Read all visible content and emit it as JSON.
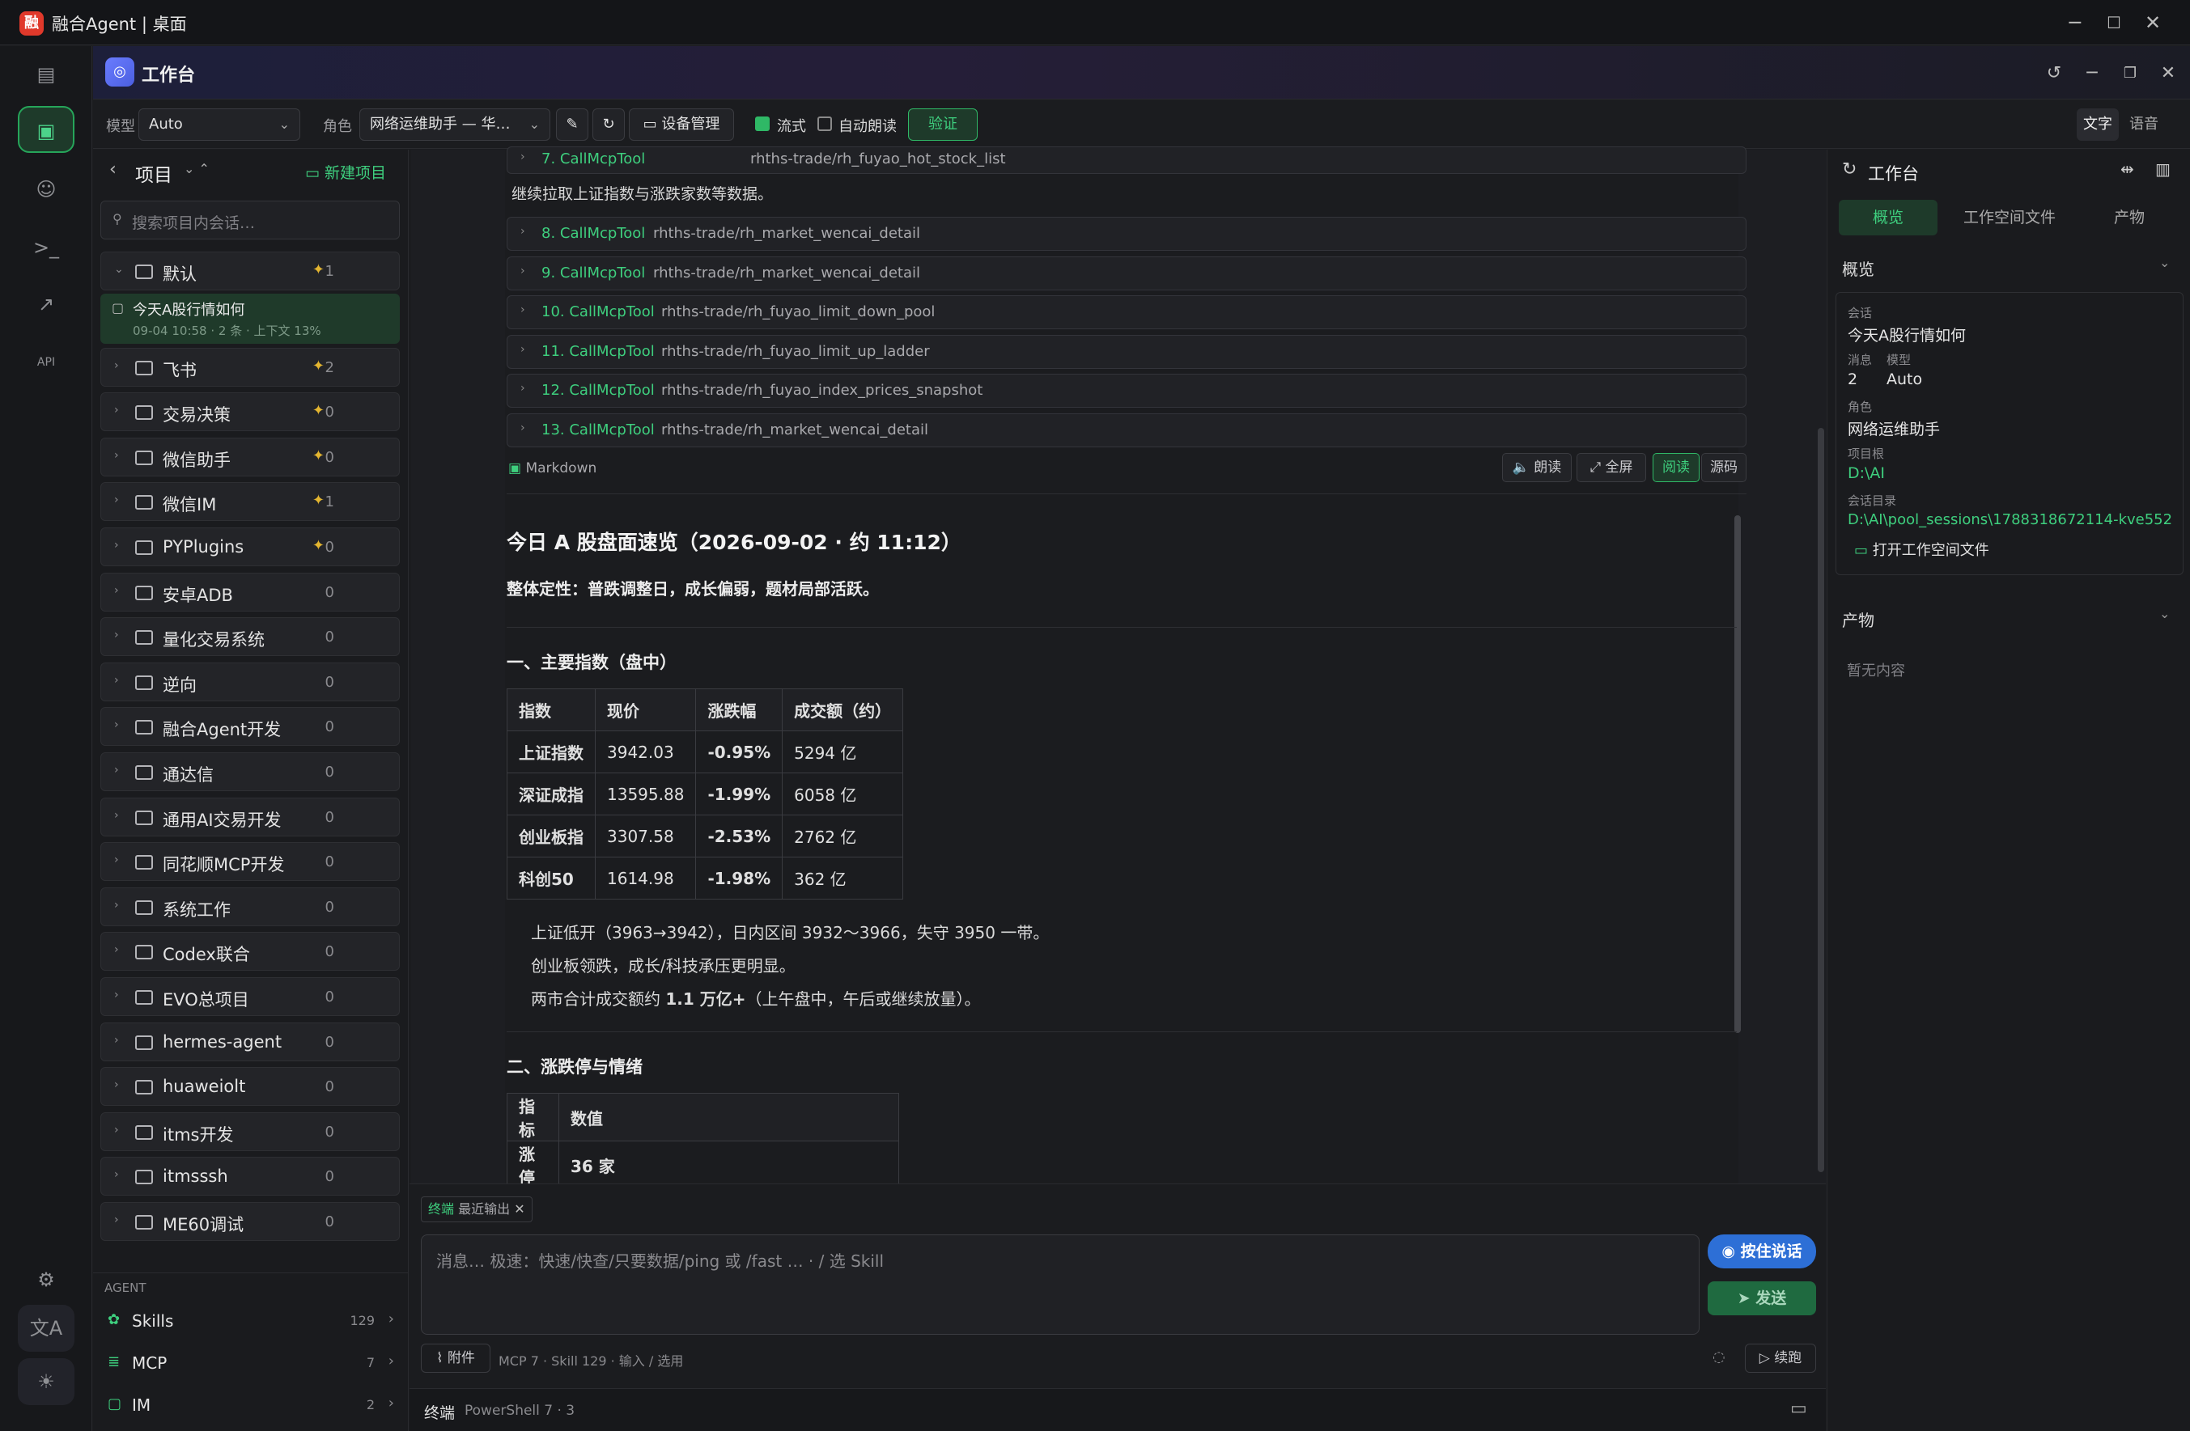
{
  "window": {
    "title": "融合Agent | 桌面",
    "logo_text": "融"
  },
  "header": {
    "title": "工作台"
  },
  "toolbar": {
    "model_label": "模型",
    "model_value": "Auto",
    "role_label": "角色",
    "role_value": "网络运维助手 — 华…",
    "device_mgmt": "设备管理",
    "stream_label": "流式",
    "stream_checked": true,
    "autoread_label": "自动朗读",
    "autoread_checked": false,
    "verify": "验证",
    "mode_text": "文字",
    "mode_voice": "语音"
  },
  "left": {
    "title": "项目",
    "new_project": "新建项目",
    "search_placeholder": "搜索项目内会话…",
    "projects": [
      {
        "name": "默认",
        "count": "1",
        "pinned": true,
        "expanded": true
      },
      {
        "name": "飞书",
        "count": "2",
        "pinned": true
      },
      {
        "name": "交易决策",
        "count": "0",
        "pinned": true
      },
      {
        "name": "微信助手",
        "count": "0",
        "pinned": true
      },
      {
        "name": "微信IM",
        "count": "1",
        "pinned": true
      },
      {
        "name": "PYPlugins",
        "count": "0",
        "pinned": true
      },
      {
        "name": "安卓ADB",
        "count": "0"
      },
      {
        "name": "量化交易系统",
        "count": "0"
      },
      {
        "name": "逆向",
        "count": "0"
      },
      {
        "name": "融合Agent开发",
        "count": "0"
      },
      {
        "name": "通达信",
        "count": "0"
      },
      {
        "name": "通用AI交易开发",
        "count": "0"
      },
      {
        "name": "同花顺MCP开发",
        "count": "0"
      },
      {
        "name": "系统工作",
        "count": "0"
      },
      {
        "name": "Codex联合",
        "count": "0"
      },
      {
        "name": "EVO总项目",
        "count": "0"
      },
      {
        "name": "hermes-agent",
        "count": "0"
      },
      {
        "name": "huaweiolt",
        "count": "0"
      },
      {
        "name": "itms开发",
        "count": "0"
      },
      {
        "name": "itmsssh",
        "count": "0"
      },
      {
        "name": "ME60调试",
        "count": "0"
      }
    ],
    "session": {
      "title": "今天A股行情如何",
      "meta": "09-04 10:58 · 2 条 · 上下文 13%"
    },
    "agent_section": "AGENT",
    "agent_items": [
      {
        "name": "Skills",
        "count": "129"
      },
      {
        "name": "MCP",
        "count": "7"
      },
      {
        "name": "IM",
        "count": "2"
      }
    ]
  },
  "main": {
    "tool_first": {
      "name": "7. CallMcpTool",
      "arg": "rhths-trade/rh_fuyao_hot_stock_list"
    },
    "note": "继续拉取上证指数与涨跌家数等数据。",
    "tools": [
      {
        "name": "8. CallMcpTool",
        "arg": "rhths-trade/rh_market_wencai_detail"
      },
      {
        "name": "9. CallMcpTool",
        "arg": "rhths-trade/rh_market_wencai_detail"
      },
      {
        "name": "10. CallMcpTool",
        "arg": "rhths-trade/rh_fuyao_limit_down_pool"
      },
      {
        "name": "11. CallMcpTool",
        "arg": "rhths-trade/rh_fuyao_limit_up_ladder"
      },
      {
        "name": "12. CallMcpTool",
        "arg": "rhths-trade/rh_fuyao_index_prices_snapshot"
      },
      {
        "name": "13. CallMcpTool",
        "arg": "rhths-trade/rh_market_wencai_detail"
      }
    ],
    "md_label": "Markdown",
    "md_read_aloud": "朗读",
    "md_fullscreen": "全屏",
    "md_read": "阅读",
    "md_source": "源码",
    "doc": {
      "h1": "今日 A 股盘面速览（2026-09-02 · 约 11:12）",
      "summary": "整体定性：普跌调整日，成长偏弱，题材局部活跃。",
      "h2_indices": "一、主要指数（盘中）",
      "index_headers": [
        "指数",
        "现价",
        "涨跌幅",
        "成交额（约）"
      ],
      "index_rows": [
        [
          "上证指数",
          "3942.03",
          "-0.95%",
          "5294 亿"
        ],
        [
          "深证成指",
          "13595.88",
          "-1.99%",
          "6058 亿"
        ],
        [
          "创业板指",
          "3307.58",
          "-2.53%",
          "2762 亿"
        ],
        [
          "科创50",
          "1614.98",
          "-1.98%",
          "362 亿"
        ]
      ],
      "bullets": [
        "上证低开（3963→3942），日内区间 3932～3966，失守 3950 一带。",
        "创业板领跌，成长/科技承压更明显。"
      ],
      "bullet3_pre": "两市合计成交额约 ",
      "bullet3_bold": "1.1 万亿+",
      "bullet3_post": "（上午盘中，午后或继续放量）。",
      "h2_limits": "二、涨跌停与情绪",
      "limit_headers": [
        "指标",
        "数值"
      ],
      "limit_rows": [
        [
          "涨停",
          "36 家"
        ]
      ]
    }
  },
  "composer": {
    "tab_label": "终端",
    "tab_sub": "最近输出",
    "placeholder": "消息… 极速：快速/快查/只要数据/ping 或 /fast … · / 选 Skill",
    "voice_btn": "按住说话",
    "send_btn": "发送",
    "attach": "附件",
    "status": "MCP 7 · Skill 129 · 输入 / 选用",
    "continue": "续跑"
  },
  "terminal": {
    "label": "终端",
    "info": "PowerShell 7 · 3"
  },
  "right": {
    "title": "工作台",
    "tabs": [
      "概览",
      "工作空间文件",
      "产物"
    ],
    "overview_title": "概览",
    "session_k": "会话",
    "session_v": "今天A股行情如何",
    "msg_k": "消息",
    "msg_v": "2",
    "model_k": "模型",
    "model_v": "Auto",
    "role_k": "角色",
    "role_v": "网络运维助手",
    "root_k": "项目根",
    "root_v": "D:\\AI",
    "dir_k": "会话目录",
    "dir_v": "D:\\AI\\pool_sessions\\1788318672114-kve552",
    "open_ws": "打开工作空间文件",
    "artifacts_title": "产物",
    "artifacts_empty": "暂无内容"
  },
  "colors": {
    "accent": "#2fb866",
    "accent_text": "#3ecf7e",
    "pin": "#e3b530",
    "voice": "#2d6fd6"
  }
}
